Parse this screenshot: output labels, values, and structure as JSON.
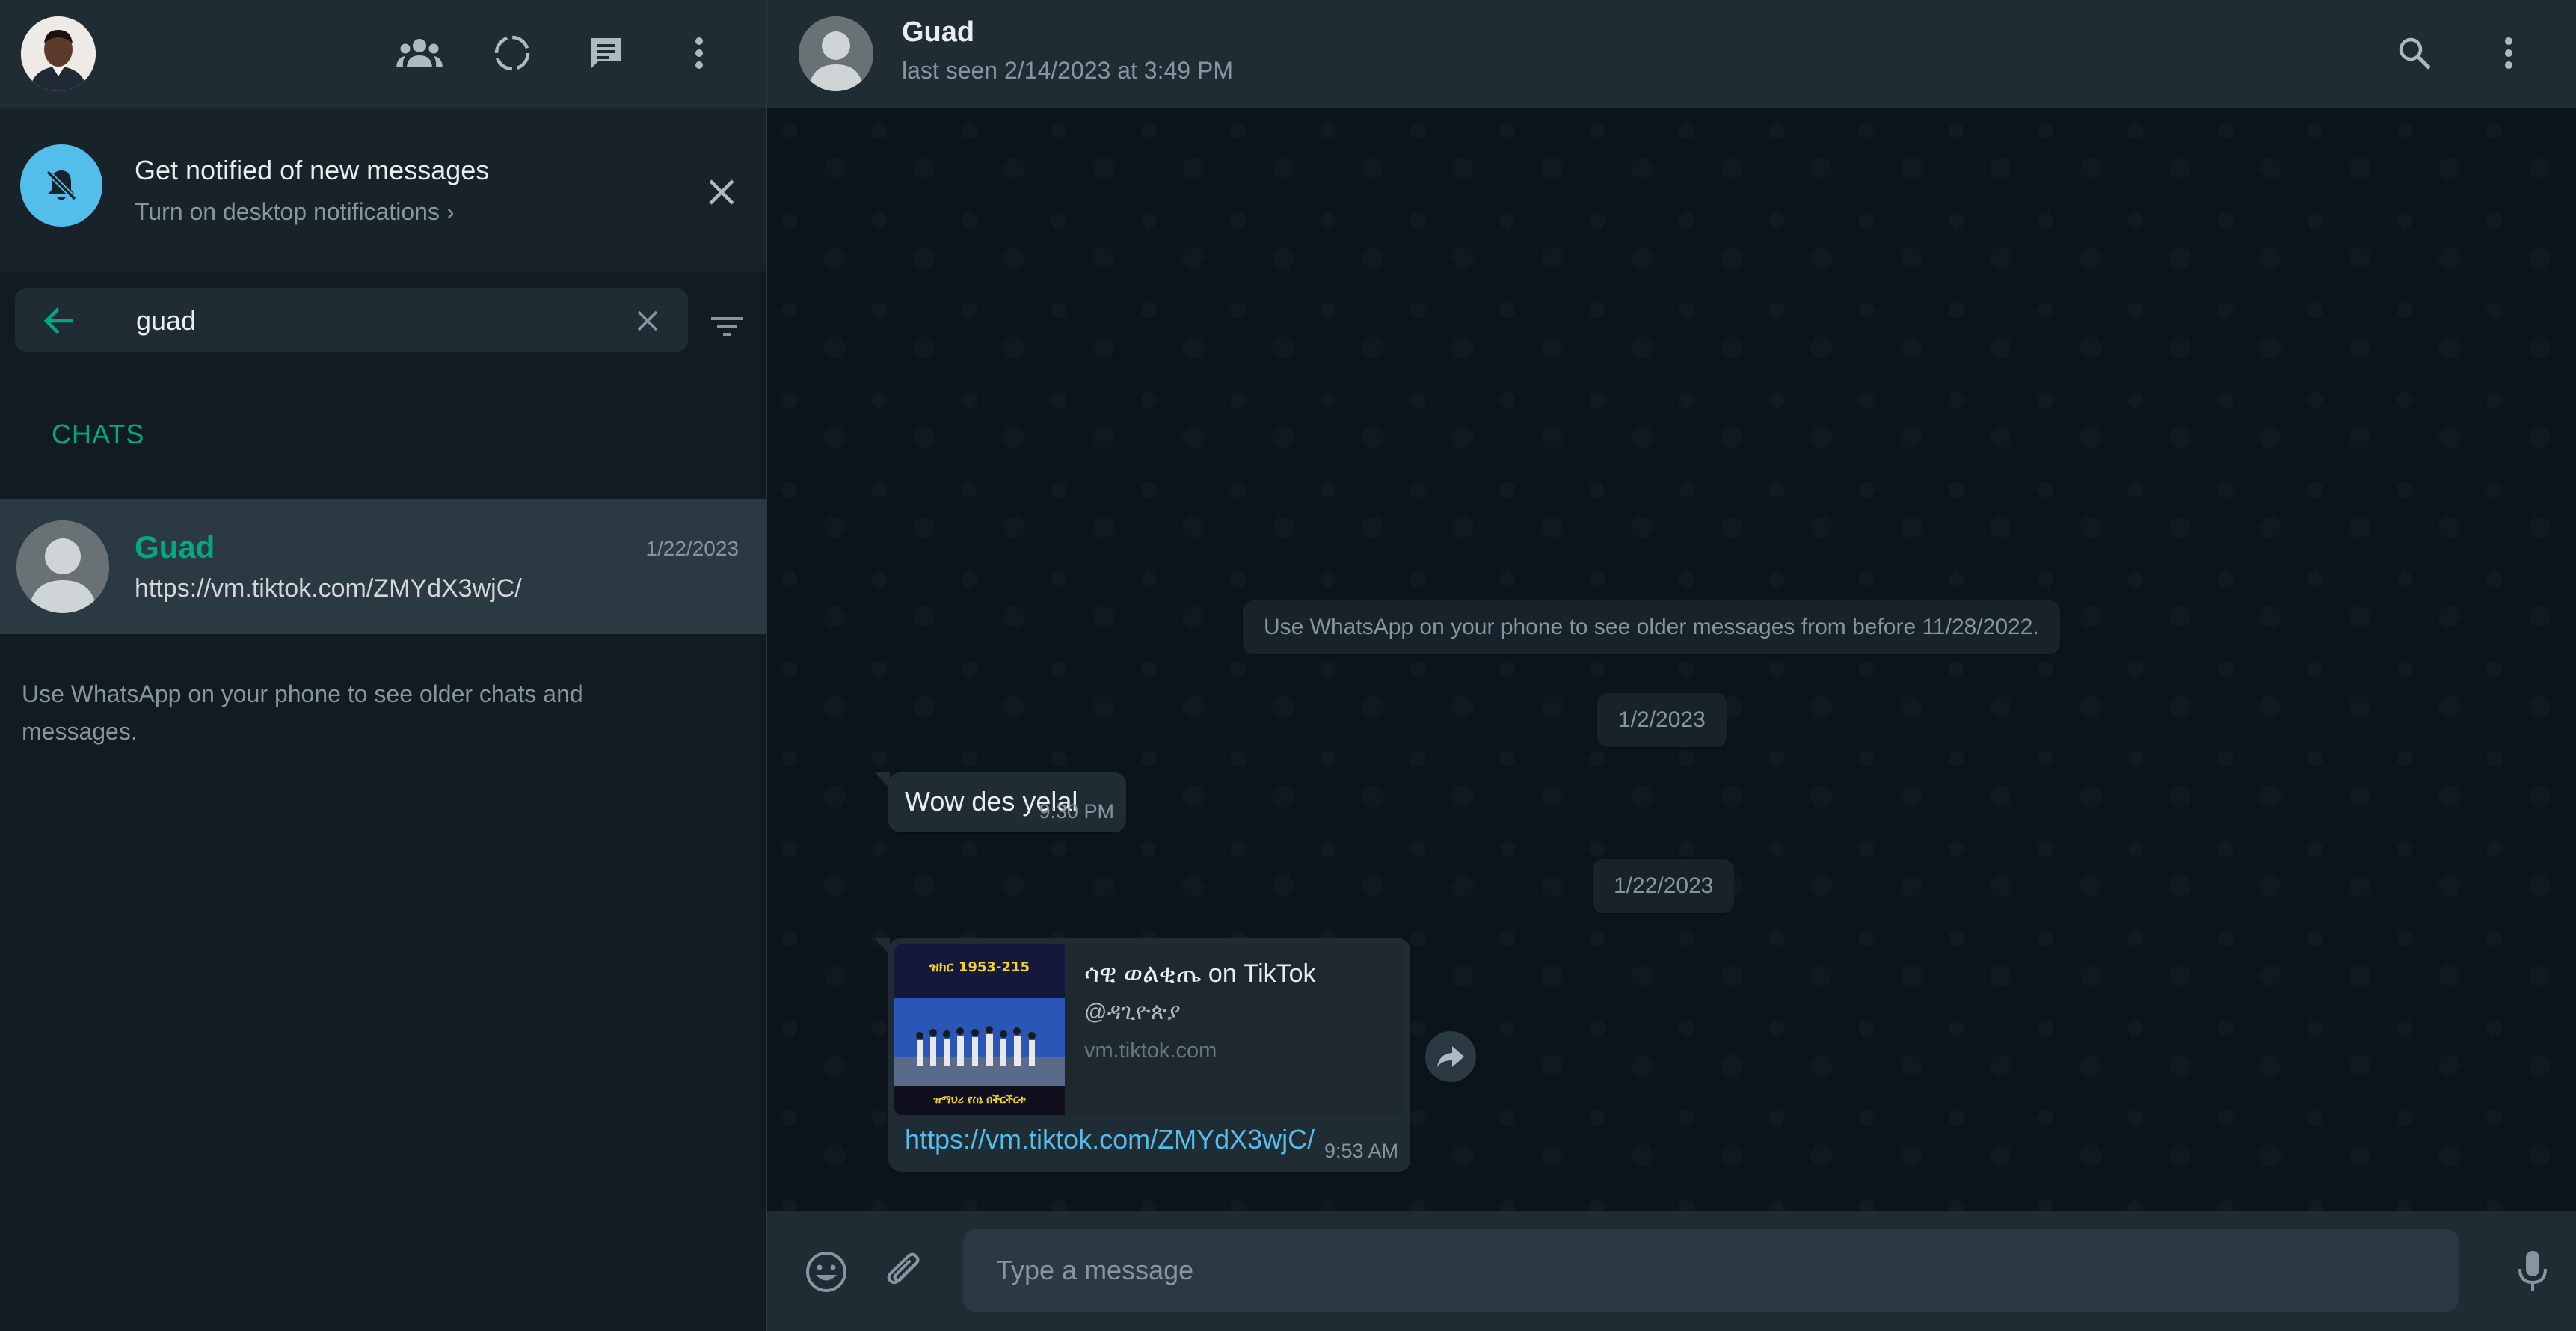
{
  "left_header": {
    "icons": [
      "communities-icon",
      "status-icon",
      "new-chat-icon",
      "menu-icon"
    ]
  },
  "notification": {
    "title": "Get notified of new messages",
    "subtitle": "Turn on desktop notifications ›"
  },
  "search": {
    "value": "guad"
  },
  "chats_label": "CHATS",
  "chat_list": [
    {
      "name": "Guad",
      "date": "1/22/2023",
      "preview": "https://vm.tiktok.com/ZMYdX3wjC/"
    }
  ],
  "older_chats_note": "Use WhatsApp on your phone to see older chats and messages.",
  "contact": {
    "name": "Guad",
    "status": "last seen 2/14/2023 at 3:49 PM"
  },
  "conversation": {
    "older_notice": "Use WhatsApp on your phone to see older messages from before 11/28/2022.",
    "date_1": "1/2/2023",
    "message_1": {
      "text": "Wow des yelal",
      "time": "9:30 PM"
    },
    "date_2": "1/22/2023",
    "message_2": {
      "card_title": "ሳዊ ወልቂጤ on TikTok",
      "card_handle": "@ዳጊዮጵያ",
      "card_domain": "vm.tiktok.com",
      "thumb_top": "ዝክር 1953-215",
      "thumb_bottom": "ዝማህሪ የስኔ በችርችርቱ",
      "link": "https://vm.tiktok.com/ZMYdX3wjC/",
      "time": "9:53 AM"
    }
  },
  "composer": {
    "placeholder": "Type a message"
  },
  "colors": {
    "accent": "#00a884",
    "panel": "#202c33",
    "background": "#111b21",
    "bubble_in": "#202c33",
    "link": "#53bdeb",
    "bell_circle": "#53bdeb"
  }
}
